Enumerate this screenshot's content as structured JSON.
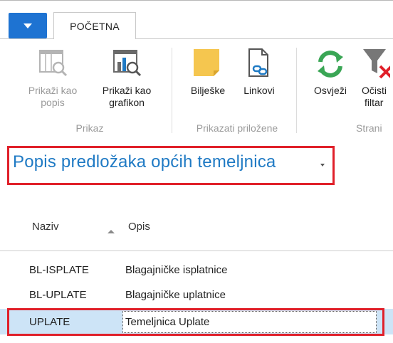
{
  "ribbon": {
    "tab_home": "POČETNA",
    "buttons": {
      "show_as_list": {
        "line1": "Prikaži kao",
        "line2": "popis"
      },
      "show_as_chart": {
        "line1": "Prikaži kao",
        "line2": "grafikon"
      },
      "notes": "Bilješke",
      "links": "Linkovi",
      "refresh": "Osvježi",
      "clear_filter": {
        "line1": "Očisti",
        "line2": "filtar"
      }
    },
    "groups": {
      "view": "Prikaz",
      "show_attached": "Prikazati priložene",
      "page": "Strani"
    }
  },
  "page": {
    "title": "Popis predložaka općih temeljnica"
  },
  "list": {
    "columns": [
      "Naziv",
      "Opis"
    ],
    "rows": [
      {
        "name": "BL-ISPLATE",
        "description": "Blagajničke isplatnice"
      },
      {
        "name": "BL-UPLATE",
        "description": "Blagajničke uplatnice"
      },
      {
        "name": "UPLATE",
        "description": "Temeljnica Uplate"
      }
    ]
  },
  "colors": {
    "accent_blue": "#1e73d2",
    "title_blue": "#1f7ac4",
    "highlight_red": "#e0202a",
    "selection_blue": "#cde4f7"
  }
}
